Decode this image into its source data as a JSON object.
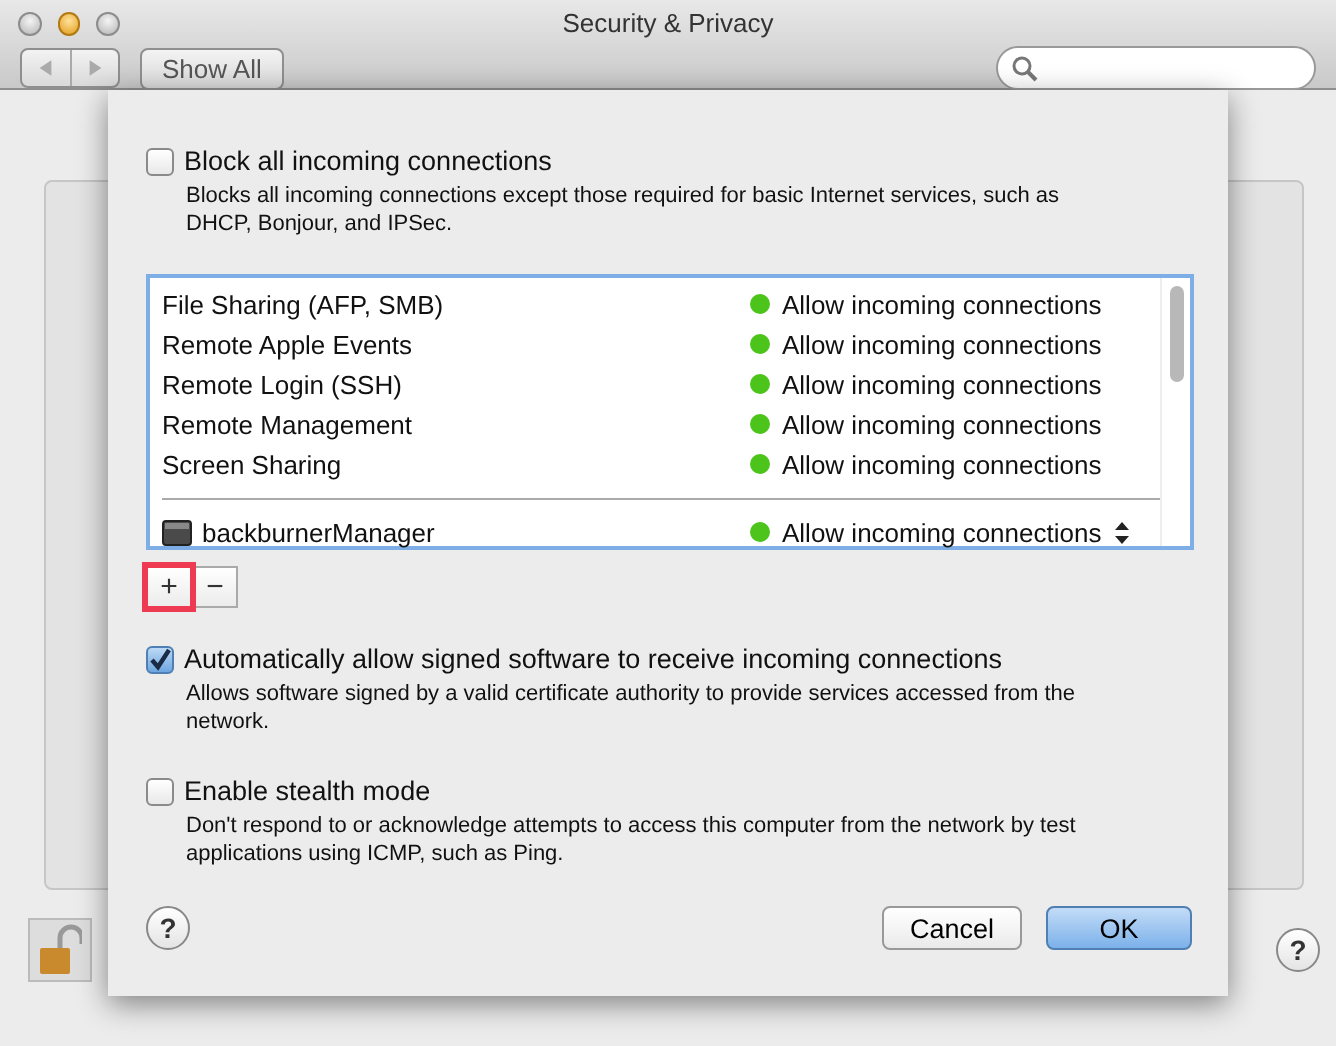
{
  "window": {
    "title": "Security & Privacy"
  },
  "toolbar": {
    "show_all": "Show All"
  },
  "footer": {
    "locked": false,
    "help": "?"
  },
  "sheet": {
    "block_all": {
      "label": "Block all incoming connections",
      "description": "Blocks all incoming connections except those required for basic Internet services, such as DHCP, Bonjour, and IPSec.",
      "checked": false
    },
    "services": [
      {
        "kind": "service",
        "name": "File Sharing (AFP, SMB)",
        "status": "Allow incoming connections",
        "color": "#4cc41c"
      },
      {
        "kind": "service",
        "name": "Remote Apple Events",
        "status": "Allow incoming connections",
        "color": "#4cc41c"
      },
      {
        "kind": "service",
        "name": "Remote Login (SSH)",
        "status": "Allow incoming connections",
        "color": "#4cc41c"
      },
      {
        "kind": "service",
        "name": "Remote Management",
        "status": "Allow incoming connections",
        "color": "#4cc41c"
      },
      {
        "kind": "service",
        "name": "Screen Sharing",
        "status": "Allow incoming connections",
        "color": "#4cc41c"
      },
      {
        "kind": "app",
        "name": "backburnerManager",
        "status": "Allow incoming connections",
        "color": "#4cc41c"
      }
    ],
    "add_button": {
      "label": "+",
      "highlighted": true
    },
    "remove_button": {
      "label": "−",
      "highlighted": false
    },
    "auto_allow": {
      "label": "Automatically allow signed software to receive incoming connections",
      "description": "Allows software signed by a valid certificate authority to provide services accessed from the network.",
      "checked": true
    },
    "stealth": {
      "label": "Enable stealth mode",
      "description": "Don't respond to or acknowledge attempts to access this computer from the network by test applications using ICMP, such as Ping.",
      "checked": false
    },
    "help": "?",
    "cancel": "Cancel",
    "ok": "OK"
  }
}
